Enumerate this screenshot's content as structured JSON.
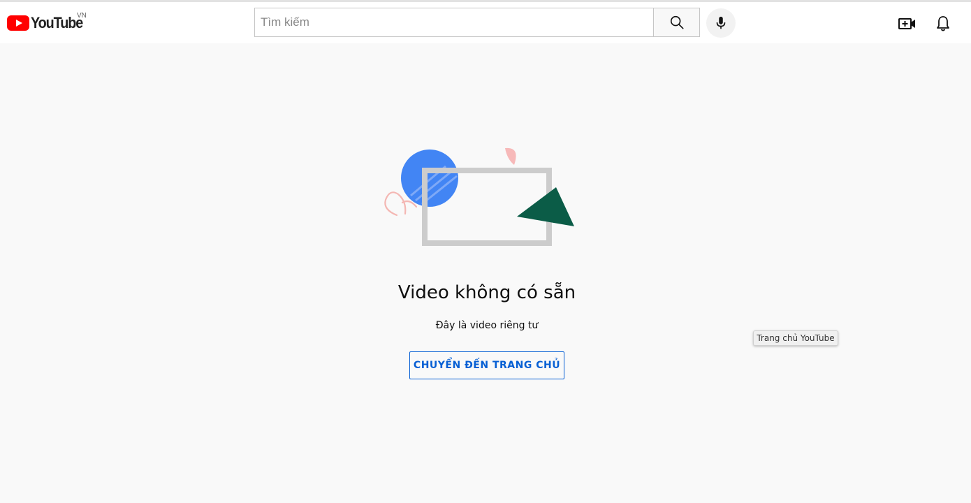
{
  "masthead": {
    "logo_text": "YouTube",
    "region_code": "VN",
    "search_placeholder": "Tìm kiếm",
    "search_value": "",
    "icons": {
      "logo": "youtube-play-logo-icon",
      "search": "search-icon",
      "mic": "microphone-icon",
      "create": "create-video-icon",
      "notifications": "bell-icon"
    }
  },
  "error": {
    "title": "Video không có sẵn",
    "message": "Đây là video riêng tư",
    "home_button_label": "CHUYỂN ĐẾN TRANG CHỦ"
  },
  "tooltip": {
    "text": "Trang chủ YouTube"
  },
  "colors": {
    "brand_red": "#ff0000",
    "link_blue": "#065fd4",
    "illustration_blue": "#4285f4",
    "illustration_green": "#0b5c47",
    "illustration_pink": "#f7b7b7",
    "illustration_frame": "#cccccc"
  }
}
